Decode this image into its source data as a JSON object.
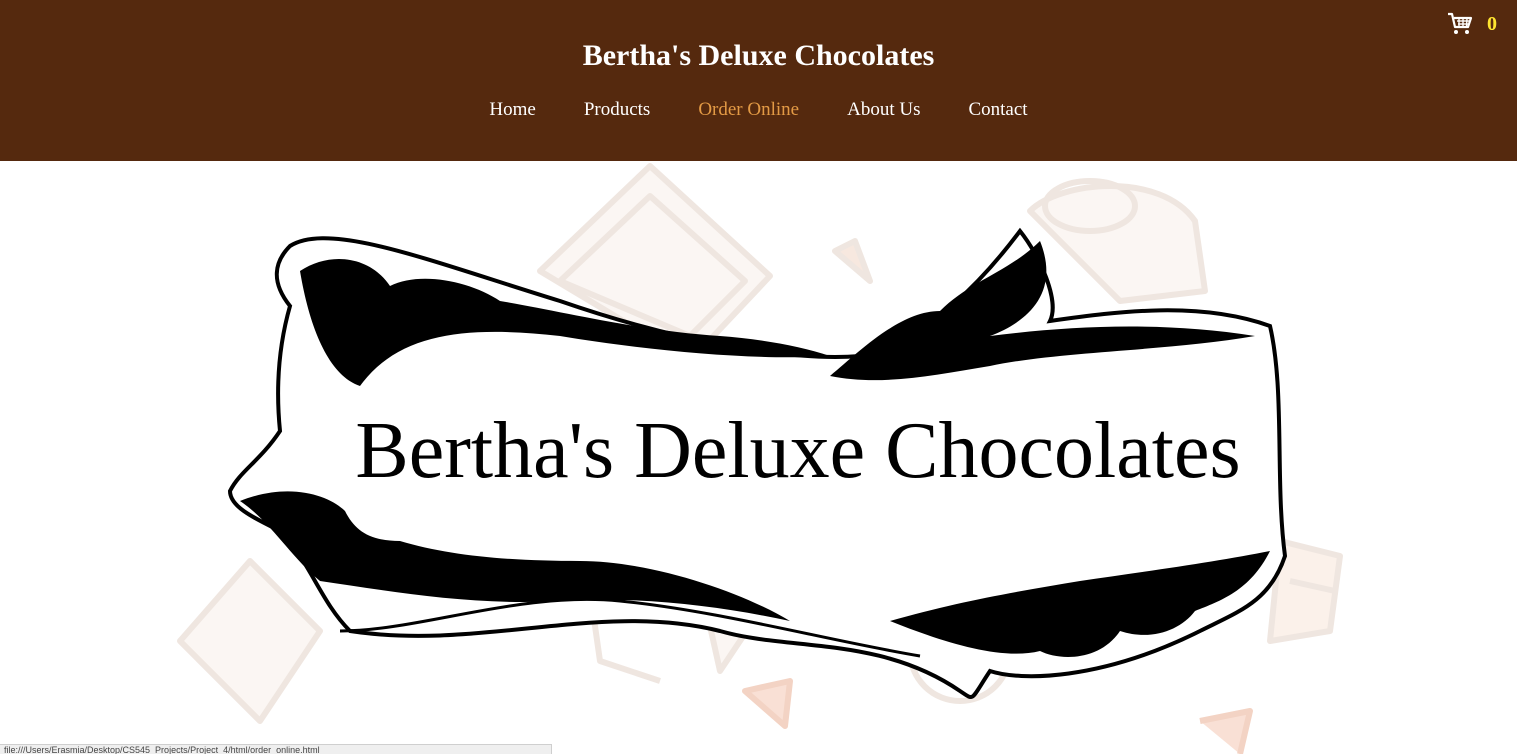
{
  "header": {
    "title": "Bertha's Deluxe Chocolates",
    "background": "#55290e"
  },
  "nav": {
    "items": [
      {
        "label": "Home",
        "active": false
      },
      {
        "label": "Products",
        "active": false
      },
      {
        "label": "Order Online",
        "active": true
      },
      {
        "label": "About Us",
        "active": false
      },
      {
        "label": "Contact",
        "active": false
      }
    ],
    "active_color": "#e39a45"
  },
  "cart": {
    "icon": "shopping-cart-icon",
    "count": "0",
    "count_color": "#ffe530"
  },
  "hero": {
    "logo_text": "Bertha's Deluxe Chocolates",
    "background_pattern": "chocolate-pieces-illustration"
  },
  "status_bar": {
    "url": "file:///Users/Erasmia/Desktop/CS545_Projects/Project_4/html/order_online.html"
  }
}
